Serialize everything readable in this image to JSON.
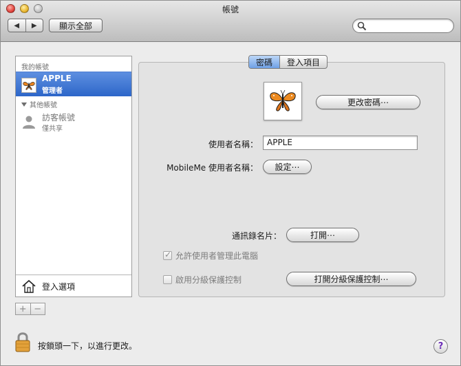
{
  "window": {
    "title": "帳號"
  },
  "toolbar": {
    "back_glyph": "◀",
    "forward_glyph": "▶",
    "show_all_label": "顯示全部",
    "search_placeholder": ""
  },
  "sidebar": {
    "my_account_header": "我的帳號",
    "selected_account": {
      "name": "APPLE",
      "role": "管理者"
    },
    "other_accounts_header": "其他帳號",
    "guest": {
      "name": "訪客帳號",
      "subtitle": "僅共享"
    },
    "login_options_label": "登入選項",
    "add_label": "+",
    "remove_label": "−"
  },
  "tabs": [
    {
      "label": "密碼",
      "active": true
    },
    {
      "label": "登入項目",
      "active": false
    }
  ],
  "password_pane": {
    "change_password_label": "更改密碼⋯",
    "username_label": "使用者名稱：",
    "username_value": "APPLE",
    "mobileme_label": "MobileMe 使用者名稱：",
    "setup_label": "設定⋯",
    "address_card_label": "通訊錄名片：",
    "open_label": "打開⋯",
    "allow_admin_label": "允許使用者管理此電腦",
    "allow_admin_checked": true,
    "parental_label": "啟用分級保護控制",
    "parental_checked": false,
    "open_parental_label": "打開分級保護控制⋯"
  },
  "footer": {
    "lock_text": "按鎖頭一下，以進行更改。",
    "help_label": "?"
  },
  "colors": {
    "selection": "#2d66c9",
    "active_tab": "#6fa0e6"
  }
}
